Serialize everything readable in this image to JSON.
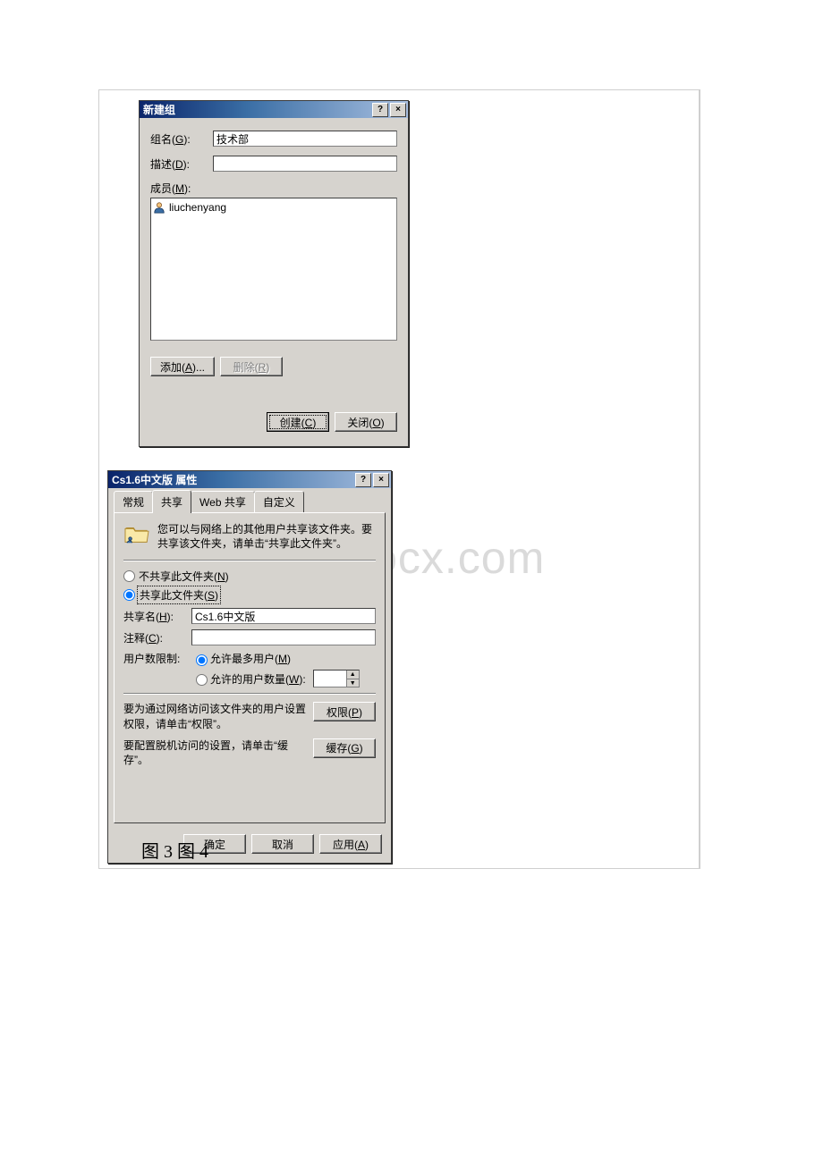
{
  "watermark": "www.bdocx.com",
  "caption": "图 3 图 4",
  "dlg1": {
    "title": "新建组",
    "help_btn": "?",
    "close_btn": "×",
    "group_name_label_pre": "组名(",
    "group_name_hotkey": "G",
    "group_name_label_post": "):",
    "group_name_value": "技术部",
    "desc_label_pre": "描述(",
    "desc_hotkey": "D",
    "desc_label_post": "):",
    "desc_value": "",
    "members_label_pre": "成员(",
    "members_hotkey": "M",
    "members_label_post": "):",
    "members": [
      "liuchenyang"
    ],
    "add_btn_pre": "添加(",
    "add_hotkey": "A",
    "add_btn_post": ")...",
    "remove_btn_pre": "删除(",
    "remove_hotkey": "R",
    "remove_btn_post": ")",
    "create_btn_pre": "创建(",
    "create_hotkey": "C",
    "create_btn_post": ")",
    "close2_btn_pre": "关闭(",
    "close2_hotkey": "O",
    "close2_btn_post": ")"
  },
  "dlg2": {
    "title": "Cs1.6中文版 属性",
    "help_btn": "?",
    "close_btn": "×",
    "tabs": {
      "general": "常规",
      "share": "共享",
      "web": "Web 共享",
      "custom": "自定义"
    },
    "info_text": "您可以与网络上的其他用户共享该文件夹。要共享该文件夹，请单击“共享此文件夹”。",
    "radio_noshare_pre": "不共享此文件夹(",
    "radio_noshare_hot": "N",
    "radio_noshare_post": ")",
    "radio_share_pre": "共享此文件夹(",
    "radio_share_hot": "S",
    "radio_share_post": ")",
    "share_name_label_pre": "共享名(",
    "share_name_hot": "H",
    "share_name_label_post": "):",
    "share_name_value": "Cs1.6中文版",
    "comment_label_pre": "注释(",
    "comment_hot": "C",
    "comment_label_post": "):",
    "comment_value": "",
    "userlimit_label": "用户数限制:",
    "userlimit_max_pre": "允许最多用户(",
    "userlimit_max_hot": "M",
    "userlimit_max_post": ")",
    "userlimit_num_pre": "允许的用户数量(",
    "userlimit_num_hot": "W",
    "userlimit_num_post": "):",
    "perm_text": "要为通过网络访问该文件夹的用户设置权限，请单击“权限”。",
    "perm_btn_pre": "权限(",
    "perm_hot": "P",
    "perm_btn_post": ")",
    "cache_text": "要配置脱机访问的设置，请单击“缓存”。",
    "cache_btn_pre": "缓存(",
    "cache_hot": "G",
    "cache_btn_post": ")",
    "ok": "确定",
    "cancel": "取消",
    "apply_pre": "应用(",
    "apply_hot": "A",
    "apply_post": ")"
  }
}
